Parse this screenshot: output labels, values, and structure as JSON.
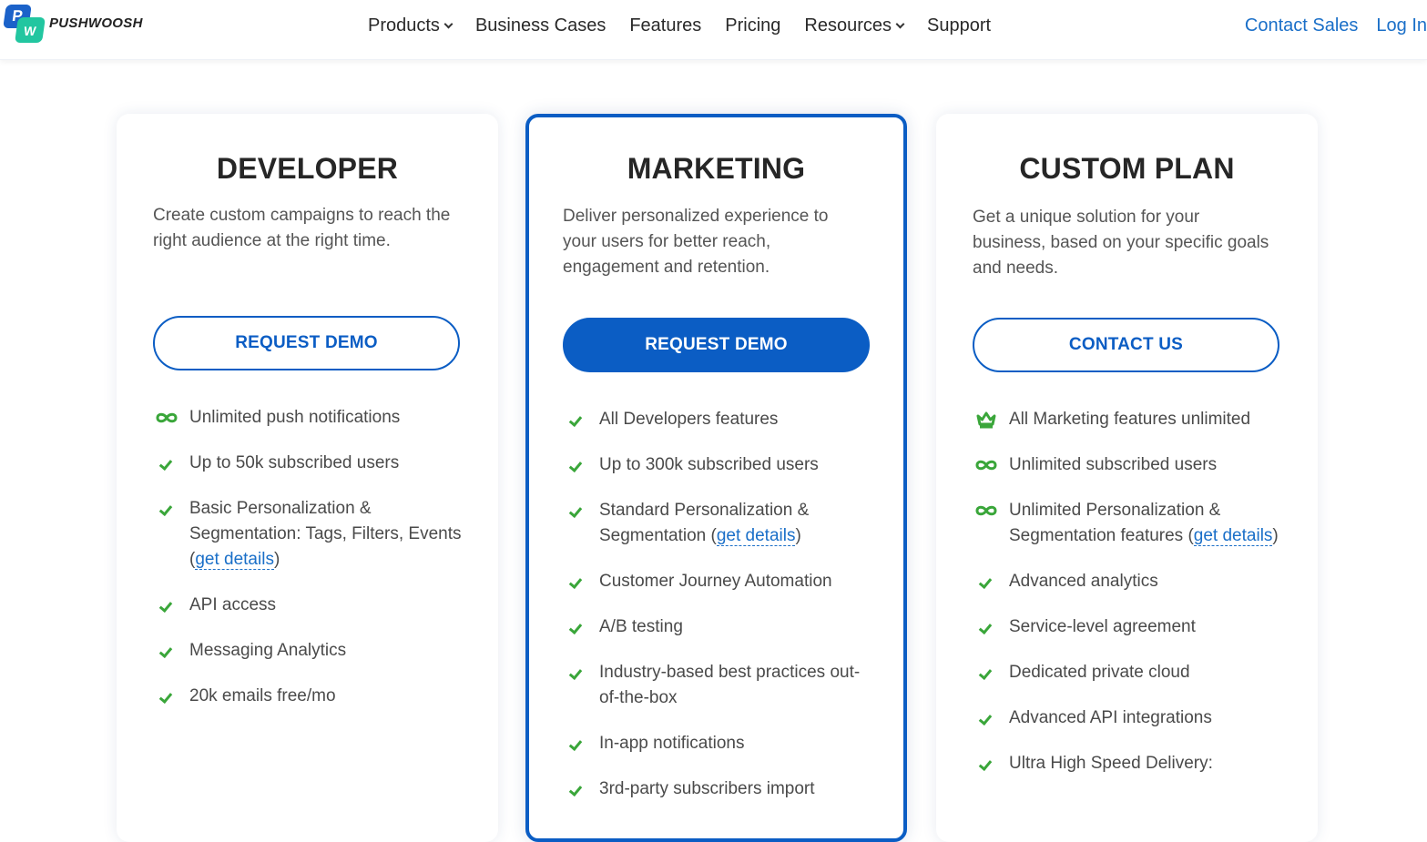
{
  "header": {
    "logo_text": "PUSHWOOSH",
    "logo_p": "P",
    "logo_w": "W",
    "nav": [
      "Products",
      "Business Cases",
      "Features",
      "Pricing",
      "Resources",
      "Support"
    ],
    "contact_sales": "Contact Sales",
    "log_in": "Log In"
  },
  "colors": {
    "brand_blue": "#0b5dc4",
    "link_blue": "#1a6fc8",
    "check_green": "#3aa63a",
    "logo_green": "#22c6a0"
  },
  "plans": {
    "developer": {
      "title": "DEVELOPER",
      "description": "Create custom campaigns to reach the right audience at the right time.",
      "cta": "REQUEST DEMO",
      "features": [
        {
          "icon": "infinity-icon",
          "text": "Unlimited push notifications"
        },
        {
          "icon": "check-icon",
          "text": "Up to 50k subscribed users"
        },
        {
          "icon": "check-icon",
          "text": "Basic Personalization & Segmentation: Tags, Filters, Events (",
          "link": "get details",
          "after": ")"
        },
        {
          "icon": "check-icon",
          "text": "API access"
        },
        {
          "icon": "check-icon",
          "text": "Messaging Analytics"
        },
        {
          "icon": "check-icon",
          "text": "20k emails free/mo"
        }
      ]
    },
    "marketing": {
      "title": "MARKETING",
      "description": "Deliver personalized experience to your users for better reach, engagement and retention.",
      "cta": "REQUEST DEMO",
      "features": [
        {
          "icon": "check-icon",
          "text": "All Developers features"
        },
        {
          "icon": "check-icon",
          "text": "Up to 300k subscribed users"
        },
        {
          "icon": "check-icon",
          "text": "Standard Personalization & Segmentation (",
          "link": "get details",
          "after": ")"
        },
        {
          "icon": "check-icon",
          "text": "Customer Journey Automation"
        },
        {
          "icon": "check-icon",
          "text": "A/B testing"
        },
        {
          "icon": "check-icon",
          "text": "Industry-based best practices out-of-the-box"
        },
        {
          "icon": "check-icon",
          "text": "In-app notifications"
        },
        {
          "icon": "check-icon",
          "text": "3rd-party subscribers import"
        }
      ]
    },
    "custom": {
      "title": "CUSTOM PLAN",
      "description": "Get a unique solution for your business, based on your specific goals and needs.",
      "cta": "CONTACT US",
      "features": [
        {
          "icon": "crown-icon",
          "text": "All Marketing features unlimited"
        },
        {
          "icon": "infinity-icon",
          "text": "Unlimited subscribed users"
        },
        {
          "icon": "infinity-icon",
          "text": "Unlimited Personalization & Segmentation features (",
          "link": "get details",
          "after": ")"
        },
        {
          "icon": "check-icon",
          "text": "Advanced analytics"
        },
        {
          "icon": "check-icon",
          "text": "Service-level agreement"
        },
        {
          "icon": "check-icon",
          "text": "Dedicated private cloud"
        },
        {
          "icon": "check-icon",
          "text": "Advanced API integrations"
        },
        {
          "icon": "check-icon",
          "text": "Ultra High Speed Delivery:"
        }
      ]
    }
  }
}
